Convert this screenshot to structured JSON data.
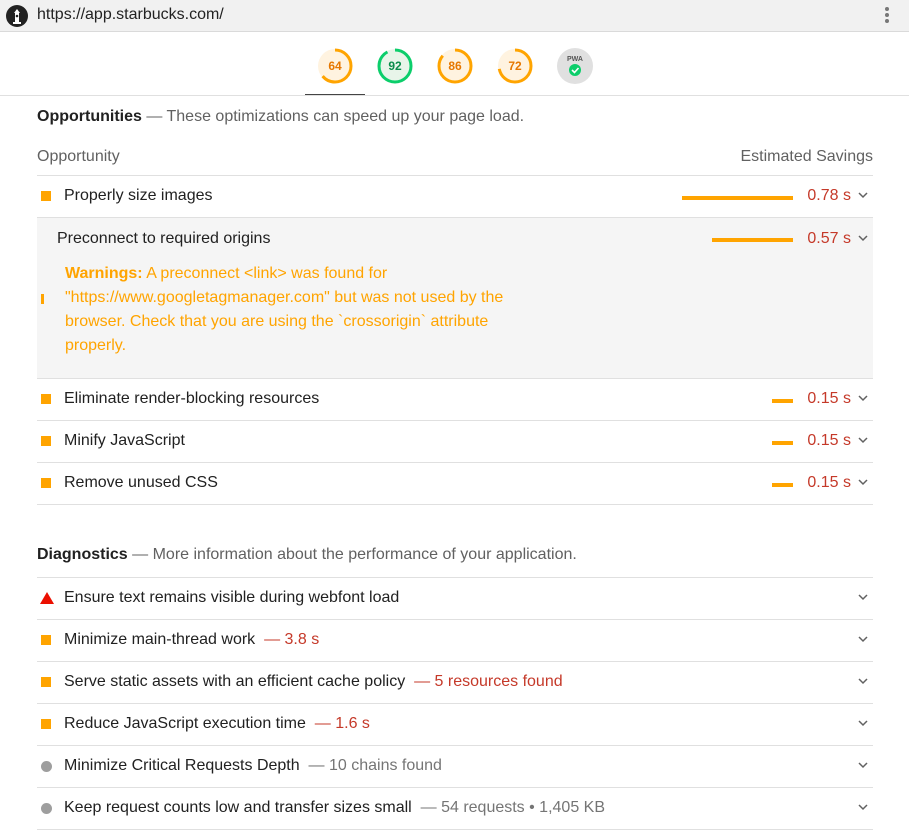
{
  "browser": {
    "url": "https://app.starbucks.com/",
    "logo_icon": "lighthouse-icon",
    "menu_icon": "kebab-menu-icon"
  },
  "scores": [
    {
      "value": "64",
      "score": 0.64,
      "color": "#ffa400",
      "bg": "#fff3e0"
    },
    {
      "value": "92",
      "score": 0.92,
      "color": "#0cce6b",
      "bg": "#e8f5e9"
    },
    {
      "value": "86",
      "score": 0.86,
      "color": "#ffa400",
      "bg": "#fff3e0"
    },
    {
      "value": "72",
      "score": 0.72,
      "color": "#ffa400",
      "bg": "#fff3e0"
    },
    {
      "value": "PWA",
      "color": "#0cce6b",
      "bg": "#e0e0e0",
      "icon": "pwa-check-icon"
    }
  ],
  "opportunities": {
    "title": "Opportunities",
    "desc": "— These optimizations can speed up your page load.",
    "col_left": "Opportunity",
    "col_right": "Estimated Savings",
    "items": [
      {
        "title": "Properly size images",
        "saving": "0.78 s",
        "seconds": 0.78
      },
      {
        "title": "Preconnect to required origins",
        "saving": "0.57 s",
        "seconds": 0.57,
        "expanded": true,
        "warning_label": "Warnings:",
        "warning_text": "A preconnect <link> was found for \"https://www.googletagmanager.com\" but was not used by the browser. Check that you are using the `crossorigin` attribute properly."
      },
      {
        "title": "Eliminate render-blocking resources",
        "saving": "0.15 s",
        "seconds": 0.15
      },
      {
        "title": "Minify JavaScript",
        "saving": "0.15 s",
        "seconds": 0.15
      },
      {
        "title": "Remove unused CSS",
        "saving": "0.15 s",
        "seconds": 0.15
      }
    ]
  },
  "diagnostics": {
    "title": "Diagnostics",
    "desc": "— More information about the performance of your application.",
    "items": [
      {
        "title": "Ensure text remains visible during webfont load",
        "extra": "",
        "status": "fail"
      },
      {
        "title": "Minimize main-thread work",
        "extra": "— 3.8 s",
        "status": "average"
      },
      {
        "title": "Serve static assets with an efficient cache policy",
        "extra": "— 5 resources found",
        "status": "average"
      },
      {
        "title": "Reduce JavaScript execution time",
        "extra": "— 1.6 s",
        "status": "average"
      },
      {
        "title": "Minimize Critical Requests Depth",
        "extra": "— 10 chains found",
        "status": "info"
      },
      {
        "title": "Keep request counts low and transfer sizes small",
        "extra": "— 54 requests • 1,405 KB",
        "status": "info"
      }
    ]
  }
}
